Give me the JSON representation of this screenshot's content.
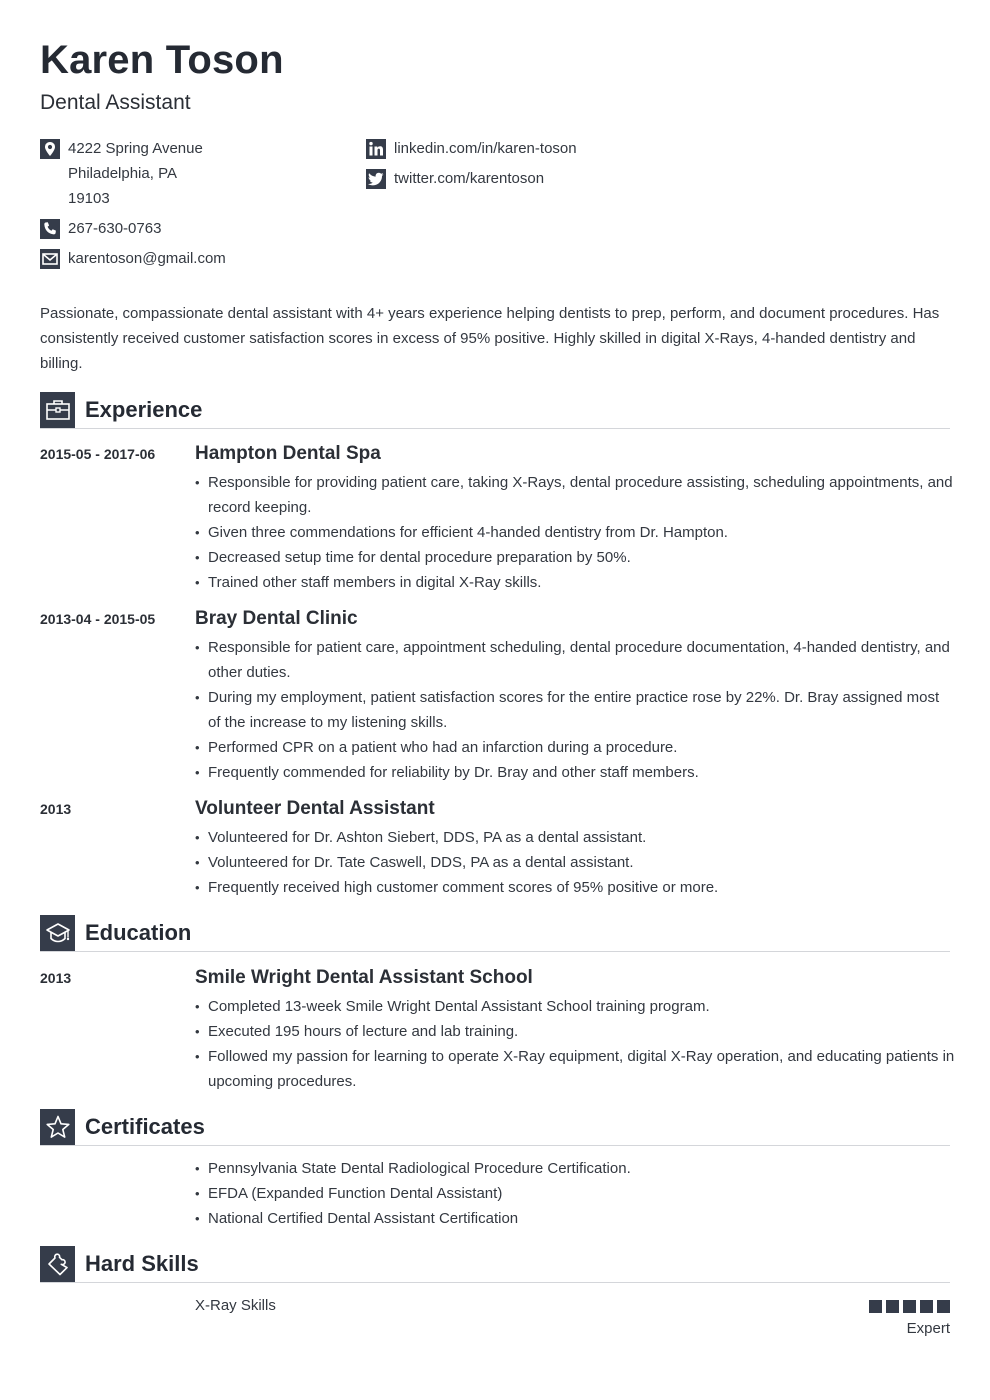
{
  "header": {
    "name": "Karen Toson",
    "job_title": "Dental Assistant"
  },
  "contact": {
    "address_lines": [
      "4222 Spring Avenue",
      "Philadelphia, PA",
      "19103"
    ],
    "phone": "267-630-0763",
    "email": "karentoson@gmail.com",
    "linkedin": "linkedin.com/in/karen-toson",
    "twitter": "twitter.com/karentoson"
  },
  "summary": "Passionate, compassionate dental assistant with 4+ years experience helping dentists to prep, perform, and document procedures. Has consistently received customer satisfaction scores in excess of 95% positive. Highly skilled in digital X-Rays, 4-handed dentistry and billing.",
  "sections": {
    "experience": {
      "label": "Experience",
      "icon": "briefcase-icon",
      "entries": [
        {
          "date": "2015-05 - 2017-06",
          "title": "Hampton Dental Spa",
          "bullets": [
            "Responsible for providing patient care, taking X-Rays, dental procedure assisting, scheduling appointments, and record keeping.",
            "Given three commendations for efficient 4-handed dentistry from Dr. Hampton.",
            "Decreased setup time for dental procedure preparation by 50%.",
            "Trained other staff members in digital X-Ray skills."
          ]
        },
        {
          "date": "2013-04 - 2015-05",
          "title": "Bray Dental Clinic",
          "bullets": [
            "Responsible for patient care, appointment scheduling, dental procedure documentation, 4-handed dentistry, and other duties.",
            "During my employment, patient satisfaction scores for the entire practice rose by 22%. Dr. Bray assigned most of the increase to my listening skills.",
            "Performed CPR on a patient who had an infarction during a procedure.",
            "Frequently commended for reliability by Dr. Bray and other staff members."
          ]
        },
        {
          "date": "2013",
          "title": "Volunteer Dental Assistant",
          "bullets": [
            "Volunteered for Dr. Ashton Siebert, DDS, PA as a dental assistant.",
            "Volunteered for Dr. Tate Caswell, DDS, PA as a dental assistant.",
            "Frequently received high customer comment scores of 95% positive or more."
          ]
        }
      ]
    },
    "education": {
      "label": "Education",
      "icon": "graduation-cap-icon",
      "entries": [
        {
          "date": "2013",
          "title": "Smile Wright Dental Assistant School",
          "bullets": [
            "Completed 13-week Smile Wright Dental Assistant School training program.",
            "Executed 195 hours of lecture and lab training.",
            "Followed my passion for learning to operate X-Ray equipment, digital X-Ray operation, and educating patients in upcoming procedures."
          ]
        }
      ]
    },
    "certificates": {
      "label": "Certificates",
      "icon": "star-icon",
      "bullets": [
        "Pennsylvania State Dental Radiological Procedure Certification.",
        "EFDA (Expanded Function Dental Assistant)",
        "National Certified Dental Assistant Certification"
      ]
    },
    "hard_skills": {
      "label": "Hard Skills",
      "icon": "puzzle-icon",
      "skills": [
        {
          "name": "X-Ray Skills",
          "level": "Expert",
          "rating": 5,
          "max": 5
        }
      ]
    }
  },
  "colors": {
    "accent": "#353c4a",
    "text": "#2b2f36",
    "divider": "#d4d6da"
  }
}
